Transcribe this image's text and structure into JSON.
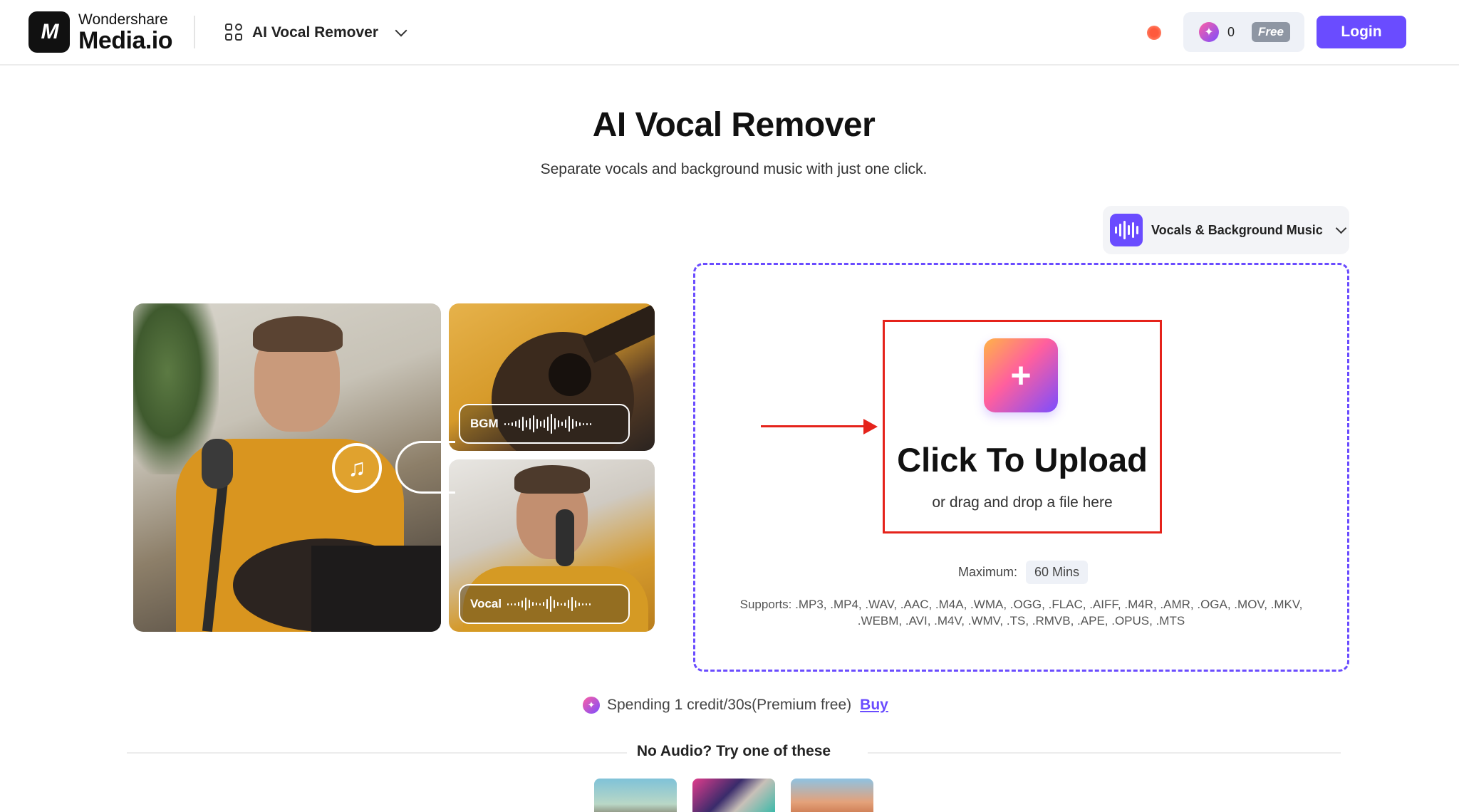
{
  "header": {
    "brand": "Wondershare",
    "product": "Media.io",
    "logo_mark": "M",
    "tool_name": "AI Vocal Remover",
    "credit_count": "0",
    "plan": "Free",
    "login_label": "Login"
  },
  "hero": {
    "title": "AI Vocal Remover",
    "subtitle": "Separate vocals and background music with just one click."
  },
  "mode": {
    "selected": "Vocals & Background Music"
  },
  "preview": {
    "bgm_label": "BGM",
    "vocal_label": "Vocal"
  },
  "upload": {
    "title": "Click To Upload",
    "hint": "or drag and drop a file here",
    "max_label": "Maximum:",
    "max_value": "60 Mins",
    "supports_line1": "Supports: .MP3, .MP4, .WAV, .AAC, .M4A, .WMA, .OGG, .FLAC, .AIFF, .M4R, .AMR, .OGA, .MOV, .MKV,",
    "supports_line2": ".WEBM, .AVI, .M4V, .WMV, .TS, .RMVB, .APE, .OPUS, .MTS"
  },
  "credits": {
    "spend_text": "Spending 1 credit/30s(Premium free)",
    "buy_label": "Buy"
  },
  "samples": {
    "title": "No Audio? Try one of these"
  },
  "colors": {
    "accent": "#6a4cff",
    "highlight": "#e5231b"
  }
}
